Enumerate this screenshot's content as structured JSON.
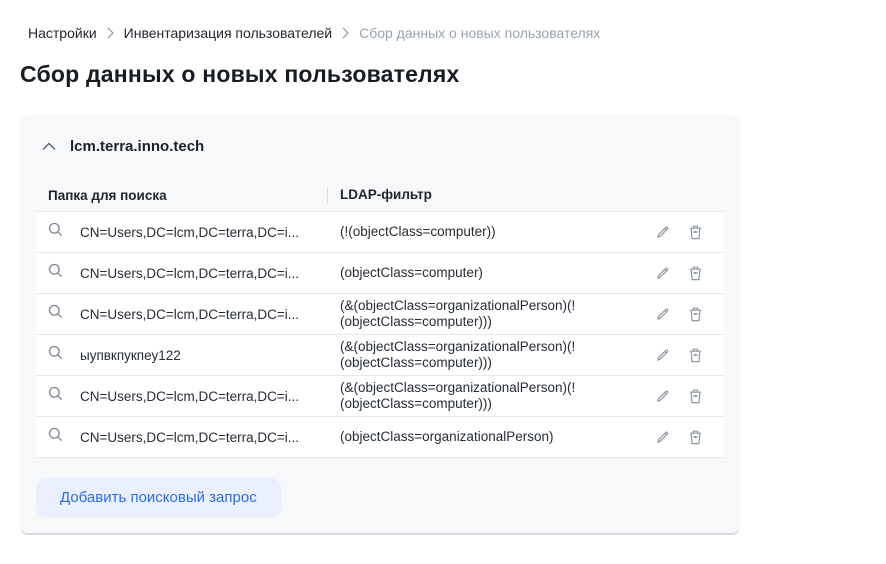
{
  "breadcrumb": {
    "separator": ">",
    "items": [
      {
        "label": "Настройки",
        "current": false
      },
      {
        "label": "Инвентаризация пользователей",
        "current": false
      },
      {
        "label": "Сбор данных о новых пользователях",
        "current": true
      }
    ]
  },
  "page": {
    "title": "Сбор данных о новых пользователях"
  },
  "panel": {
    "title": "lcm.terra.inno.tech",
    "collapsed": false,
    "table": {
      "columns": [
        "Папка для поиска",
        "LDAP-фильтр"
      ],
      "rows": [
        {
          "folder": "CN=Users,DC=lcm,DC=terra,DC=i...",
          "filter": "(!(objectClass=computer))"
        },
        {
          "folder": "CN=Users,DC=lcm,DC=terra,DC=i...",
          "filter": "(objectClass=computer)"
        },
        {
          "folder": "CN=Users,DC=lcm,DC=terra,DC=i...",
          "filter": "(&(objectClass=organizationalPerson)(!(objectClass=computer)))"
        },
        {
          "folder": "ыупвкпукпеу122",
          "filter": "(&(objectClass=organizationalPerson)(!(objectClass=computer)))"
        },
        {
          "folder": "CN=Users,DC=lcm,DC=terra,DC=i...",
          "filter": "(&(objectClass=organizationalPerson)(!(objectClass=computer)))"
        },
        {
          "folder": "CN=Users,DC=lcm,DC=terra,DC=i...",
          "filter": "(objectClass=organizationalPerson)"
        }
      ]
    },
    "add_button_label": "Добавить поисковый запрос"
  },
  "colors": {
    "panel_background": "#f7f8fa",
    "panel_bottom_border": "#d6d9de",
    "row_border": "#e7e9ed",
    "text_primary": "#20252d",
    "text_muted": "#9aa3ad",
    "icon_gray": "#8e97a1",
    "button_background": "#e9f0fc",
    "button_text": "#2e6ce3"
  },
  "icons": {
    "breadcrumb_separator": "chevron-right-icon",
    "panel_toggle": "chevron-up-icon",
    "row_lookup": "search-icon",
    "row_edit": "pencil-icon",
    "row_delete": "trash-icon"
  }
}
